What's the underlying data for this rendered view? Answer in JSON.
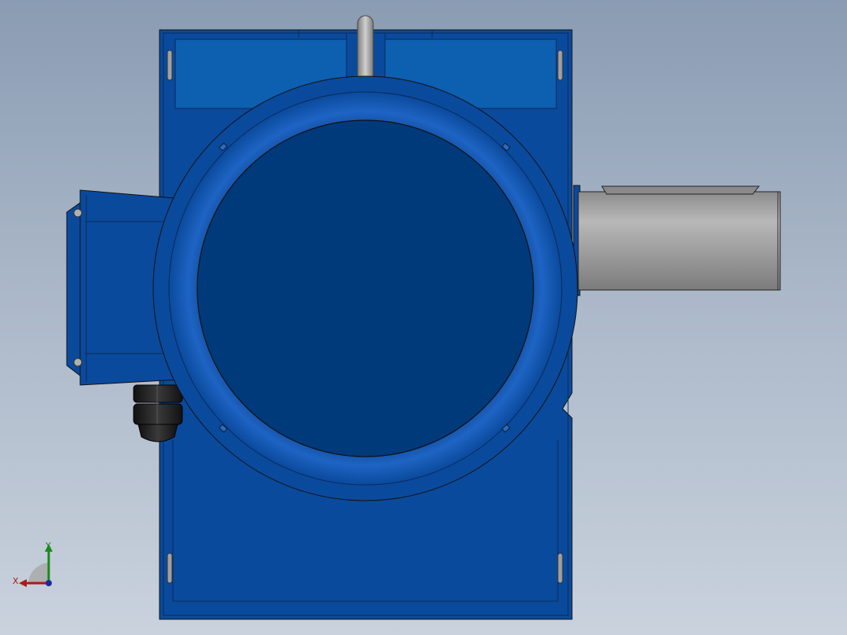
{
  "viewport": {
    "background_top": "#8a9cb3",
    "background_bottom": "#c9d2dd"
  },
  "model": {
    "body_color": "#0a4a9c",
    "body_dark": "#003a7a",
    "shaft_color": "#9a9a9a",
    "gland_color": "#1e1e1e",
    "hook_color": "#a8a8a8"
  },
  "triad": {
    "x_label": "X",
    "y_label": "Y",
    "x_color": "#b01818",
    "y_color": "#1a8a1a",
    "z_color": "#1b2b9a",
    "icon": "coordinate-triad-icon"
  }
}
